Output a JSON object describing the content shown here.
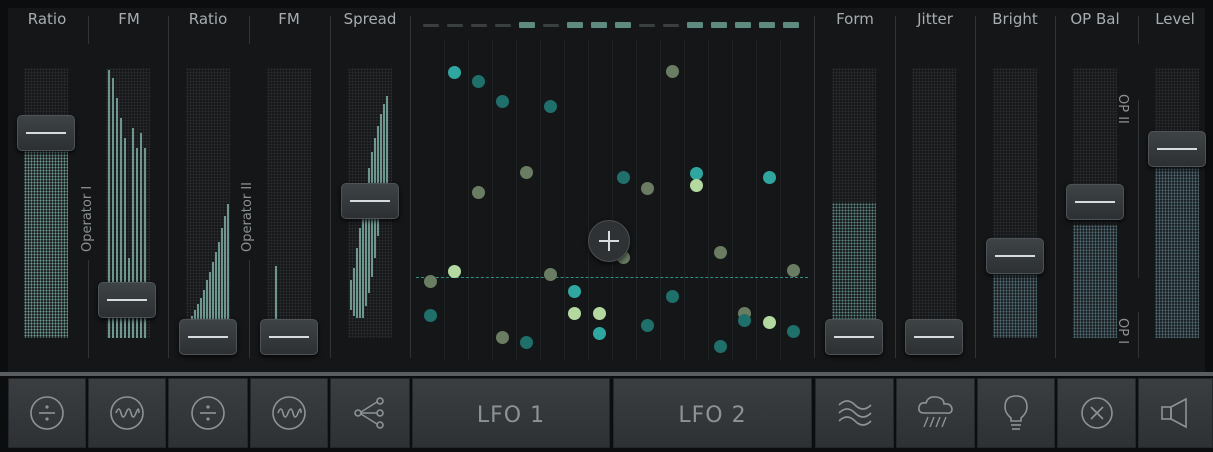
{
  "columns": {
    "left": [
      {
        "label": "Ratio",
        "value": 0.78
      },
      {
        "label": "FM",
        "value": 0.14
      },
      {
        "label": "Ratio",
        "value": 0.0
      },
      {
        "label": "FM",
        "value": 0.0
      },
      {
        "label": "Spread",
        "value": 0.5
      }
    ],
    "right": [
      {
        "label": "Form",
        "value": 0.0
      },
      {
        "label": "Jitter",
        "value": 0.0
      },
      {
        "label": "Bright",
        "value": 0.32
      },
      {
        "label": "OP Bal",
        "value": 0.52
      },
      {
        "label": "Level",
        "value": 0.72
      }
    ]
  },
  "operator_labels": {
    "op1": "Operator I",
    "op2": "Operator II",
    "opbal_top": "OP II",
    "opbal_bottom": "OP I"
  },
  "sequencer": [
    false,
    false,
    false,
    false,
    true,
    false,
    true,
    true,
    true,
    false,
    false,
    true,
    true,
    true,
    true,
    true
  ],
  "colors": {
    "teal": "#2fa7a0",
    "dark_teal": "#1f6f6b",
    "olive": "#6a7d62",
    "light_green": "#b4d9a0",
    "fill": "#6f9d94"
  },
  "buttons": [
    {
      "name": "ratio-divide-button",
      "icon": "divide-icon"
    },
    {
      "name": "fm-wave-button",
      "icon": "wave-icon"
    },
    {
      "name": "ratio2-divide-button",
      "icon": "divide-icon"
    },
    {
      "name": "fm2-wave-button",
      "icon": "wave-icon"
    },
    {
      "name": "spread-share-button",
      "icon": "share-icon"
    },
    {
      "name": "lfo1-button",
      "label": "LFO 1"
    },
    {
      "name": "lfo2-button",
      "label": "LFO 2"
    },
    {
      "name": "form-button",
      "icon": "waves-icon"
    },
    {
      "name": "jitter-button",
      "icon": "rain-cloud-icon"
    },
    {
      "name": "bright-button",
      "icon": "lightbulb-icon"
    },
    {
      "name": "opbal-button",
      "icon": "circle-x-icon"
    },
    {
      "name": "level-button",
      "icon": "speaker-icon"
    }
  ]
}
